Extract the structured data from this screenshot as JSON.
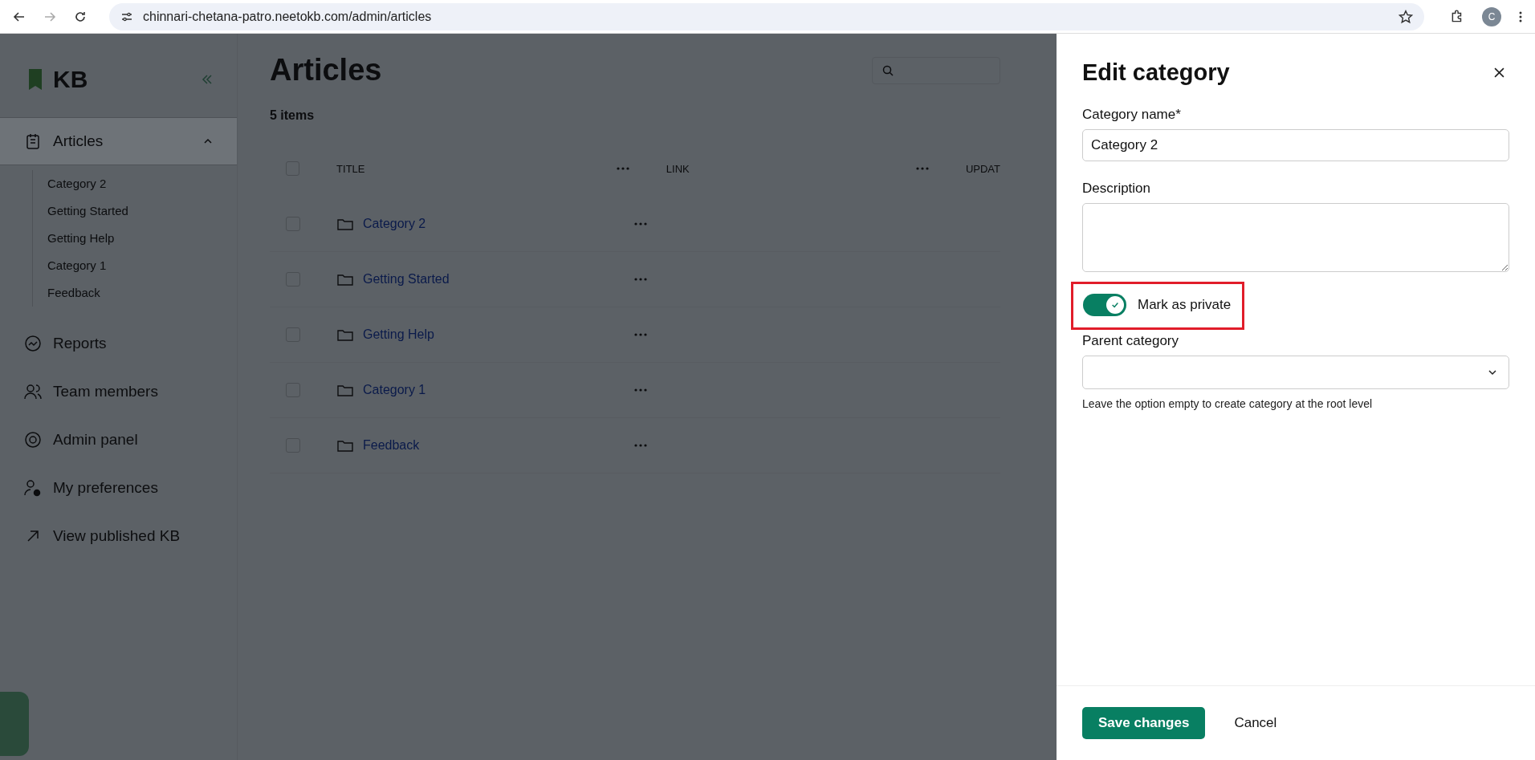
{
  "browser": {
    "url": "chinnari-chetana-patro.neetokb.com/admin/articles",
    "profile_letter": "C"
  },
  "sidebar": {
    "logo": "KB",
    "items": [
      {
        "label": "Articles",
        "selected": true,
        "expanded": true,
        "children": [
          {
            "label": "Category 2"
          },
          {
            "label": "Getting Started"
          },
          {
            "label": "Getting Help"
          },
          {
            "label": "Category 1"
          },
          {
            "label": "Feedback"
          }
        ]
      },
      {
        "label": "Reports",
        "selected": false
      },
      {
        "label": "Team members",
        "selected": false
      },
      {
        "label": "Admin panel",
        "selected": false
      },
      {
        "label": "My preferences",
        "selected": false
      },
      {
        "label": "View published KB",
        "selected": false
      }
    ]
  },
  "page": {
    "title": "Articles",
    "count": "5 items",
    "table": {
      "select_all_checked": false,
      "columns": [
        "TITLE",
        "LINK",
        "UPDAT"
      ],
      "rows": [
        {
          "title": "Category 2",
          "checked": false
        },
        {
          "title": "Getting Started",
          "checked": false
        },
        {
          "title": "Getting Help",
          "checked": false
        },
        {
          "title": "Category 1",
          "checked": false
        },
        {
          "title": "Feedback",
          "checked": false
        }
      ]
    }
  },
  "panel": {
    "title": "Edit category",
    "name_label": "Category name*",
    "name_value": "Category 2",
    "description_label": "Description",
    "private_toggle": {
      "label": "Mark as private",
      "on": true,
      "highlighted": true
    },
    "parent_label": "Parent category",
    "parent_hint": "Leave the option empty to create category at the root level",
    "buttons": [
      {
        "label": "Save changes",
        "kind": "primary"
      },
      {
        "label": "Cancel",
        "kind": "text"
      }
    ]
  }
}
